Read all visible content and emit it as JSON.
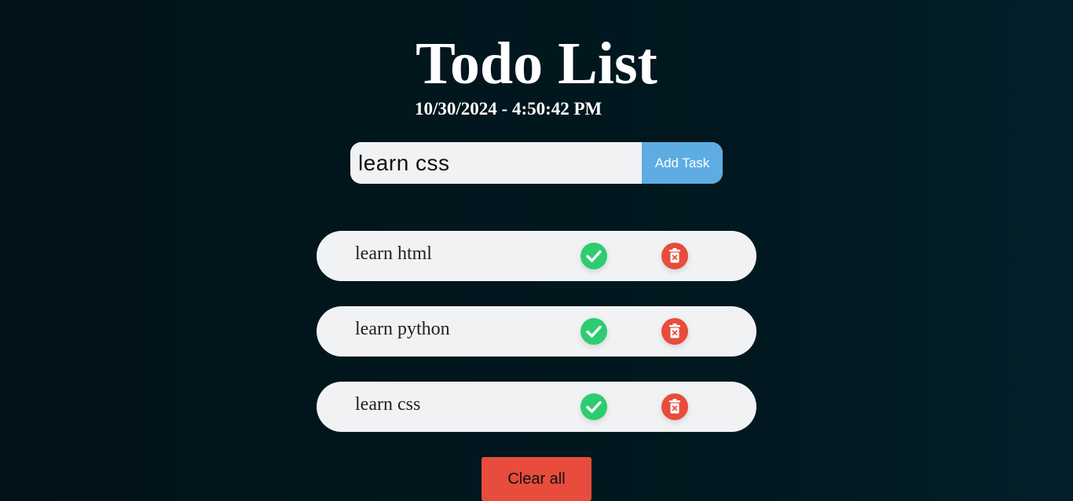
{
  "header": {
    "title": "Todo List",
    "datetime": "10/30/2024 - 4:50:42 PM"
  },
  "input": {
    "value": "learn css",
    "add_label": "Add Task"
  },
  "tasks": [
    {
      "text": "learn html",
      "complete_icon": "check-circle-icon",
      "delete_icon": "trash-icon"
    },
    {
      "text": "learn python",
      "complete_icon": "check-circle-icon",
      "delete_icon": "trash-icon"
    },
    {
      "text": "learn css",
      "complete_icon": "check-circle-icon",
      "delete_icon": "trash-icon"
    }
  ],
  "clear_all_label": "Clear all",
  "colors": {
    "accent_blue": "#5dade2",
    "complete_green": "#2ecc71",
    "delete_red": "#e74c3c",
    "item_background": "#f1f2f4"
  }
}
